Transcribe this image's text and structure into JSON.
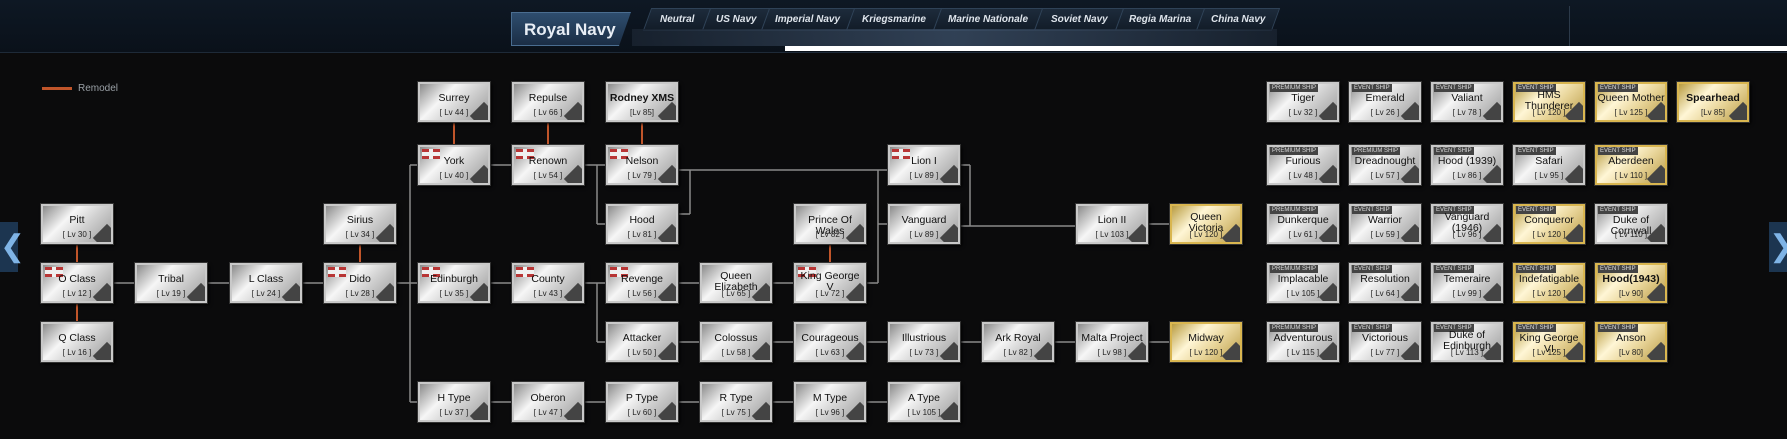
{
  "header": {
    "title": "Royal Navy",
    "tabs": [
      "Neutral",
      "US Navy",
      "Imperial Navy",
      "Kriegsmarine",
      "Marine Nationale",
      "Soviet Navy",
      "Regia Marina",
      "China Navy"
    ]
  },
  "legend": {
    "label": "Remodel",
    "color": "#c0552a"
  },
  "nav": {
    "left_arrow": "❮",
    "right_arrow": "❯"
  },
  "colors": {
    "remodel_line": "#c0552a",
    "tree_line": "#8a8a8a",
    "gold_border": "#d9b650"
  },
  "ships": {
    "surrey": {
      "name": "Surrey",
      "level": "[ Lv 44 ]"
    },
    "repulse": {
      "name": "Repulse",
      "level": "[ Lv 66 ]"
    },
    "rodney": {
      "name": "Rodney XMS",
      "level": "[Lv 85]"
    },
    "york": {
      "name": "York",
      "level": "[ Lv 40 ]"
    },
    "renown": {
      "name": "Renown",
      "level": "[ Lv 54 ]"
    },
    "nelson": {
      "name": "Nelson",
      "level": "[ Lv 79 ]"
    },
    "lion1": {
      "name": "Lion I",
      "level": "[ Lv 89 ]"
    },
    "pitt": {
      "name": "Pitt",
      "level": "[ Lv 30 ]"
    },
    "sirius": {
      "name": "Sirius",
      "level": "[ Lv 34 ]"
    },
    "hood": {
      "name": "Hood",
      "level": "[ Lv 81 ]"
    },
    "pow": {
      "name": "Prince Of Wales",
      "level": "[ Lv 82 ]"
    },
    "vanguard": {
      "name": "Vanguard",
      "level": "[ Lv 89 ]"
    },
    "lion2": {
      "name": "Lion II",
      "level": "[ Lv 103 ]"
    },
    "qvic": {
      "name": "Queen Victoria",
      "level": "[ Lv 120 ]"
    },
    "oclass": {
      "name": "O Class",
      "level": "[ Lv 12 ]"
    },
    "tribal": {
      "name": "Tribal",
      "level": "[ Lv 19 ]"
    },
    "lclass": {
      "name": "L Class",
      "level": "[ Lv 24 ]"
    },
    "dido": {
      "name": "Dido",
      "level": "[ Lv 28 ]"
    },
    "edinburgh": {
      "name": "Edinburgh",
      "level": "[ Lv 35 ]"
    },
    "county": {
      "name": "County",
      "level": "[ Lv 43 ]"
    },
    "revenge": {
      "name": "Revenge",
      "level": "[ Lv 56 ]"
    },
    "qe": {
      "name": "Queen Elizabeth",
      "level": "[ Lv 65 ]"
    },
    "kgv": {
      "name": "King George V",
      "level": "[ Lv 72 ]"
    },
    "qclass": {
      "name": "Q Class",
      "level": "[ Lv 16 ]"
    },
    "attacker": {
      "name": "Attacker",
      "level": "[ Lv 50 ]"
    },
    "colossus": {
      "name": "Colossus",
      "level": "[ Lv 58 ]"
    },
    "courageous": {
      "name": "Courageous",
      "level": "[ Lv 63 ]"
    },
    "illustrious": {
      "name": "Illustrious",
      "level": "[ Lv 73 ]"
    },
    "arkroyal": {
      "name": "Ark Royal",
      "level": "[ Lv 82 ]"
    },
    "malta": {
      "name": "Malta Project",
      "level": "[ Lv 98 ]"
    },
    "midway": {
      "name": "Midway",
      "level": "[ Lv 120 ]"
    },
    "htype": {
      "name": "H Type",
      "level": "[ Lv 37 ]"
    },
    "oberon": {
      "name": "Oberon",
      "level": "[ Lv 47 ]"
    },
    "ptype": {
      "name": "P Type",
      "level": "[ Lv 60 ]"
    },
    "rtype": {
      "name": "R Type",
      "level": "[ Lv 75 ]"
    },
    "mtype": {
      "name": "M Type",
      "level": "[ Lv 96 ]"
    },
    "atype": {
      "name": "A Type",
      "level": "[ Lv 105 ]"
    },
    "tiger": {
      "name": "Tiger",
      "level": "[ Lv 32 ]"
    },
    "emerald": {
      "name": "Emerald",
      "level": "[ Lv 26 ]"
    },
    "valiant": {
      "name": "Valiant",
      "level": "[ Lv 78 ]"
    },
    "thunderer": {
      "name": "HMS Thunderer",
      "level": "[ Lv 120 ]"
    },
    "qmother": {
      "name": "Queen Mother",
      "level": "[ Lv 125 ]"
    },
    "spearhead": {
      "name": "Spearhead",
      "level": "[Lv 85]"
    },
    "furious": {
      "name": "Furious",
      "level": "[ Lv 48 ]"
    },
    "dreadnought": {
      "name": "Dreadnought",
      "level": "[ Lv 57 ]"
    },
    "hood1939": {
      "name": "Hood (1939)",
      "level": "[ Lv 86 ]"
    },
    "safari": {
      "name": "Safari",
      "level": "[ Lv 95 ]"
    },
    "aberdeen": {
      "name": "Aberdeen",
      "level": "[ Lv 110 ]"
    },
    "dunkerque": {
      "name": "Dunkerque",
      "level": "[ Lv 61 ]"
    },
    "warrior": {
      "name": "Warrior",
      "level": "[ Lv 59 ]"
    },
    "vanguard1946": {
      "name": "Vanguard (1946)",
      "level": "[ Lv 96 ]"
    },
    "conqueror": {
      "name": "Conqueror",
      "level": "[ Lv 120 ]"
    },
    "cornwall": {
      "name": "Duke of Cornwall",
      "level": "[ Lv 110 ]"
    },
    "implacable": {
      "name": "Implacable",
      "level": "[ Lv 105 ]"
    },
    "resolution": {
      "name": "Resolution",
      "level": "[ Lv 64 ]"
    },
    "temeraire": {
      "name": "Temeraire",
      "level": "[ Lv 99 ]"
    },
    "indefatigable": {
      "name": "Indefatigable",
      "level": "[ Lv 120 ]"
    },
    "hood1943": {
      "name": "Hood(1943)",
      "level": "[Lv 90]"
    },
    "adventurous": {
      "name": "Adventurous",
      "level": "[ Lv 115 ]"
    },
    "victorious": {
      "name": "Victorious",
      "level": "[ Lv 77 ]"
    },
    "edinburghduke": {
      "name": "Duke of Edinburgh",
      "level": "[ Lv 113 ]"
    },
    "kgv6": {
      "name": "King George VI",
      "level": "[ Lv 125 ]"
    },
    "anson": {
      "name": "Anson",
      "level": "[Lv 80]"
    }
  },
  "tags": {
    "event": "EVENT SHIP",
    "premium": "PREMIUM SHIP"
  }
}
